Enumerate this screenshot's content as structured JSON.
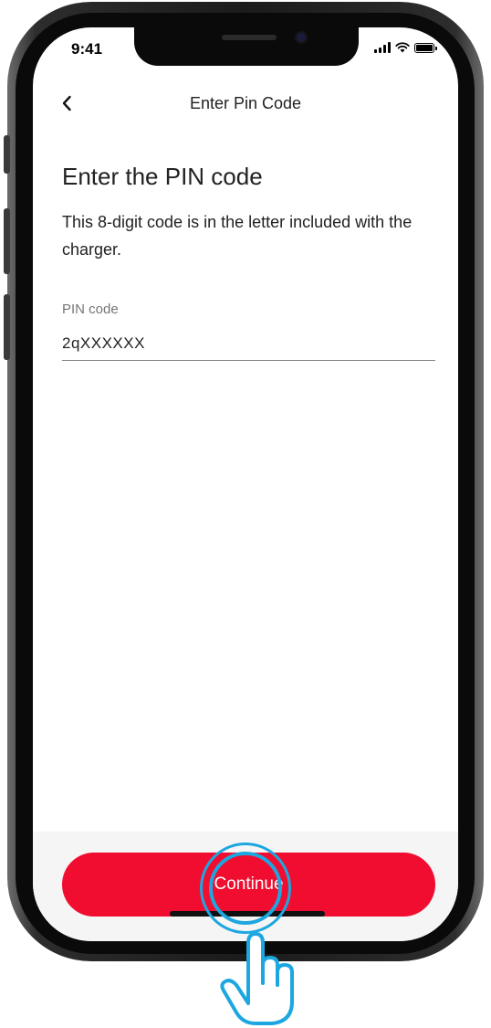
{
  "status_bar": {
    "time": "9:41",
    "signal_icon": "cellular-signal-icon",
    "wifi_icon": "wifi-icon",
    "battery_icon": "battery-icon"
  },
  "nav": {
    "back_icon": "chevron-left-icon",
    "title": "Enter Pin Code"
  },
  "content": {
    "heading": "Enter the PIN code",
    "description": "This 8-digit code is in the letter included with the charger.",
    "pin_field": {
      "label": "PIN code",
      "value": "2qXXXXXX"
    }
  },
  "footer": {
    "continue_label": "Continue"
  },
  "overlay": {
    "tap_indicator_icon": "tap-hand-icon"
  },
  "colors": {
    "accent": "#f10d2f",
    "tap_indicator": "#1da7e0",
    "text": "#222222",
    "label": "#757575"
  }
}
